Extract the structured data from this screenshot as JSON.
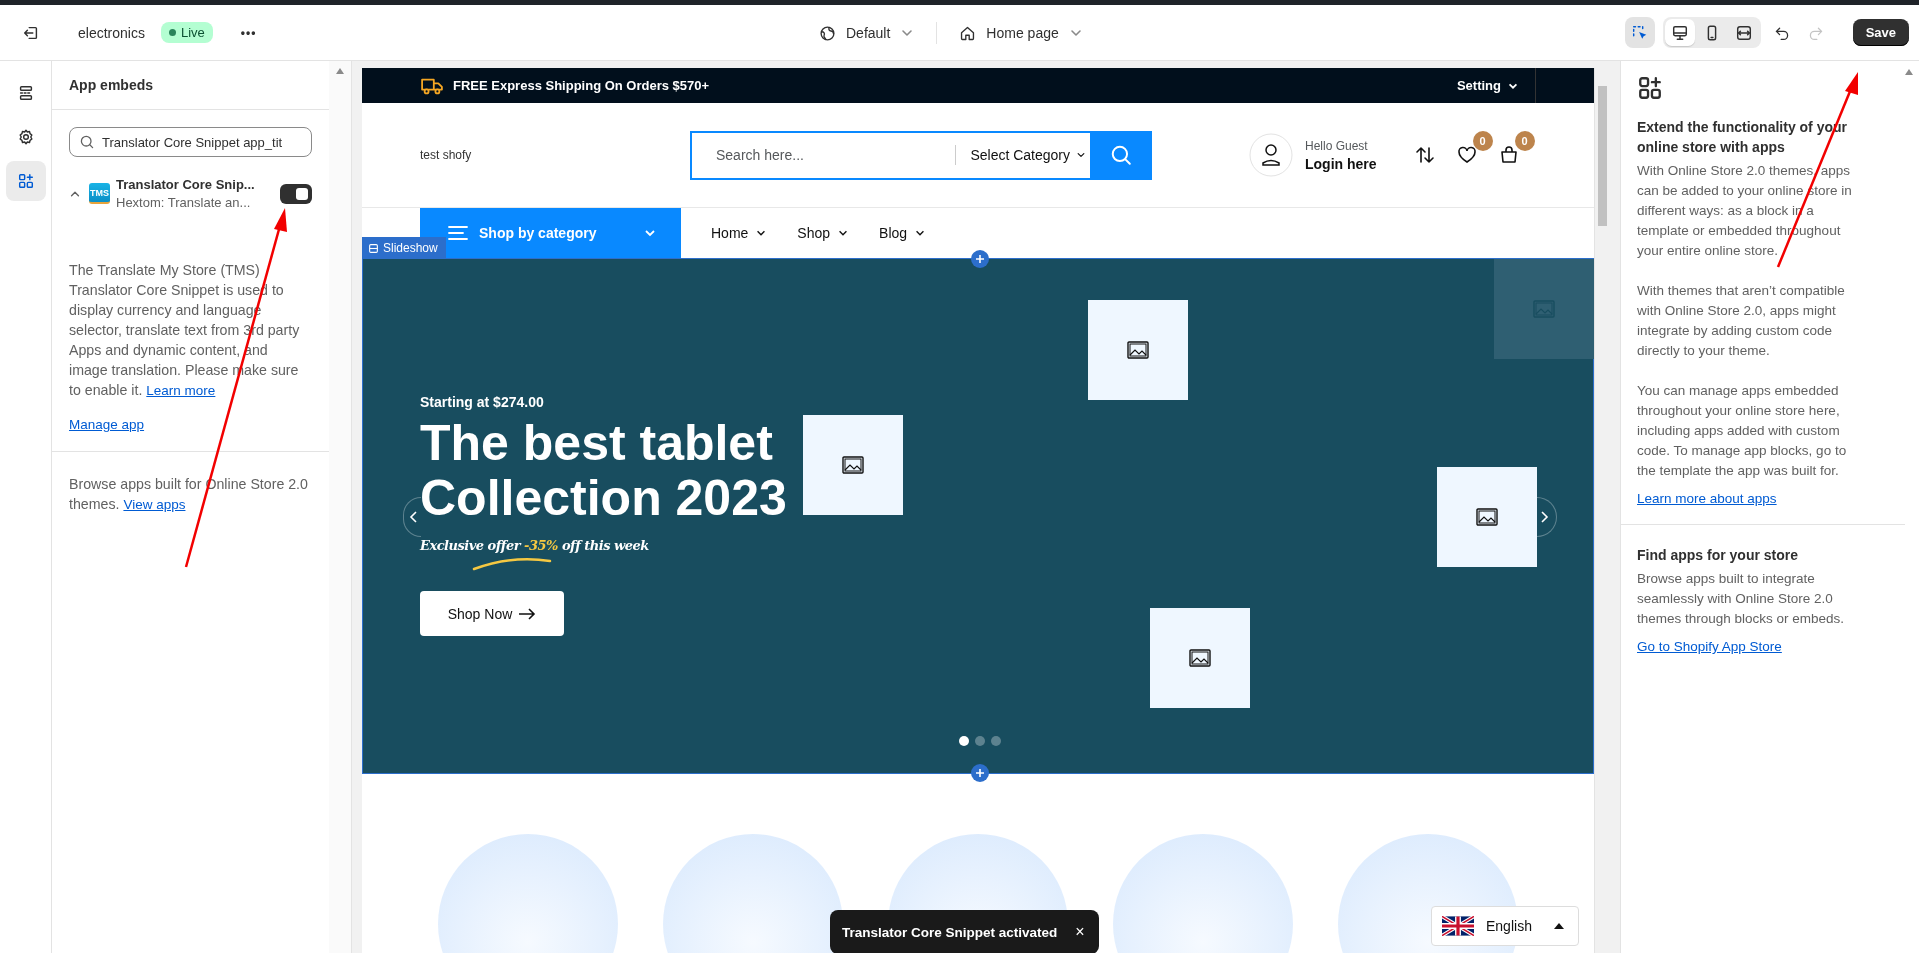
{
  "top_bar": {
    "store_name": "electronics",
    "status_badge": "Live",
    "more": "•••",
    "theme": "Default",
    "page": "Home page",
    "tools": [
      {
        "kind": "inspector",
        "selected": true
      }
    ],
    "view_modes": [
      {
        "kind": "desktop",
        "selected": true
      },
      {
        "kind": "mobile",
        "selected": false
      },
      {
        "kind": "fullwidth",
        "selected": false
      }
    ],
    "redo_disabled": true,
    "save": "Save"
  },
  "rail": [
    {
      "kind": "sections",
      "selected": false
    },
    {
      "kind": "settings",
      "selected": false
    },
    {
      "kind": "apps",
      "selected": true
    }
  ],
  "left_panel": {
    "title": "App embeds",
    "search": {
      "value": "Translator Core Snippet app_tit"
    },
    "embed": {
      "expanded": true,
      "logo": "TMS",
      "title": "Translator Core Snip...",
      "subtitle": "Hextom: Translate an...",
      "on": true,
      "description": "The Translate My Store (TMS) Translator Core Snippet is used to display currency and language selector, translate text from 3rd party Apps and dynamic content, and image translation. Please make sure to enable it.",
      "learn_more": "Learn more",
      "manage": "Manage app"
    },
    "browse_text": "Browse apps built for Online Store 2.0 themes.",
    "view_apps": "View apps"
  },
  "preview": {
    "announcement": {
      "text": "FREE Express Shipping On Orders $570+",
      "setting": "Setting"
    },
    "header": {
      "logo": "test shofy",
      "search_placeholder": "Search here...",
      "category": "Select Category",
      "greeting": "Hello Guest",
      "login": "Login here",
      "wishlist_count": "0",
      "cart_count": "0"
    },
    "nav": {
      "category_button": "Shop by category",
      "links": [
        {
          "label": "Home"
        },
        {
          "label": "Shop"
        },
        {
          "label": "Blog"
        }
      ]
    },
    "section_label": "Slideshow",
    "hero": {
      "eyebrow": "Starting at $274.00",
      "title": "The best tablet Collection 2023",
      "offer": {
        "before": "Exclusive offer",
        "highlight": "-35%",
        "after": "off this week"
      },
      "button": "Shop Now",
      "dots": [
        {
          "selected": true
        },
        {
          "selected": false
        },
        {
          "selected": false
        }
      ]
    },
    "toast": {
      "text": "Translator Core Snippet activated",
      "close": "×"
    },
    "language": {
      "label": "English"
    }
  },
  "right_panel": {
    "heading": "Extend the functionality of your online store with apps",
    "paragraphs": [
      "With Online Store 2.0 themes, apps can be added to your online store in different ways: as a block in a template or embedded throughout your entire online store.",
      "With themes that aren’t compatible with Online Store 2.0, apps might integrate by adding custom code directly to your theme.",
      "You can manage apps embedded throughout your online store here, including apps added with custom code. To manage app blocks, go to the template the app was built for."
    ],
    "link": "Learn more about apps",
    "find": {
      "heading": "Find apps for your store",
      "text": "Browse apps built to integrate seamlessly with Online Store 2.0 themes through blocks or embeds.",
      "link": "Go to Shopify App Store"
    }
  }
}
